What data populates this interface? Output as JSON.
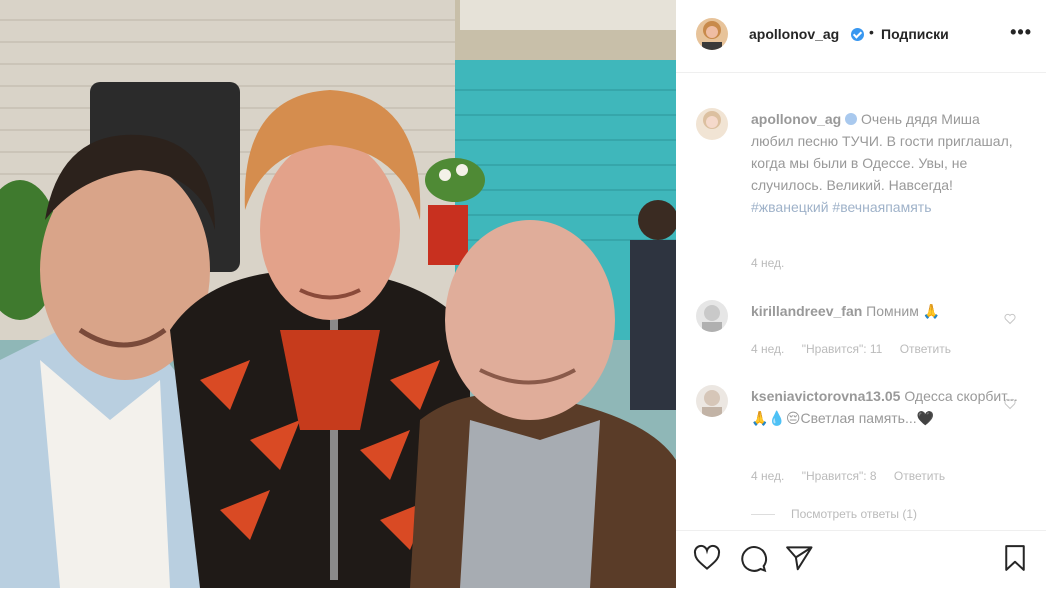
{
  "post": {
    "username": "apollonov_ag",
    "separator": "•",
    "follow_label": "Подписки",
    "more_label": "•••"
  },
  "caption": {
    "username": "apollonov_ag",
    "text": "Очень дядя Миша любил песню ТУЧИ. В гости приглашал, когда мы были в Одессе. Увы, не случилось. Великий. Навсегда!",
    "hashtags": [
      "#жванецкий",
      "#вечнаяпамять"
    ],
    "time": "4 нед."
  },
  "comments": [
    {
      "username": "kirillandreev_fan",
      "text": "Помним 🙏",
      "time": "4 нед.",
      "likes": "\"Нравится\": 11",
      "reply": "Ответить"
    },
    {
      "username": "kseniavictorovna13.05",
      "text": "Одесса скорбит...🙏💧😔Светлая память...🖤",
      "time": "4 нед.",
      "likes": "\"Нравится\": 8",
      "reply": "Ответить"
    }
  ],
  "view_replies": "Посмотреть ответы (1)",
  "icons": {
    "like": "heart-icon",
    "comment": "comment-icon",
    "share": "share-icon",
    "save": "bookmark-icon",
    "verified": "verified-badge-icon"
  },
  "colors": {
    "accent": "#3897f0",
    "hashtag": "#9fb2c9"
  }
}
